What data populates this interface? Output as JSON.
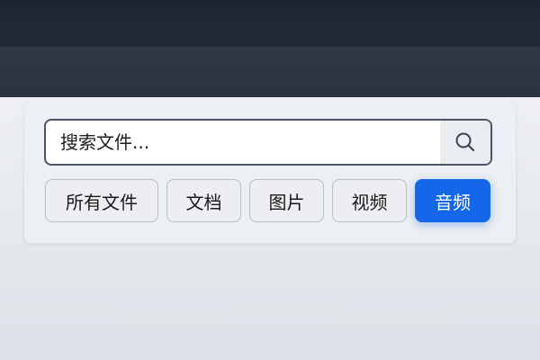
{
  "search": {
    "placeholder": "搜索文件..."
  },
  "filters": [
    {
      "label": "所有文件",
      "active": false
    },
    {
      "label": "文档",
      "active": false
    },
    {
      "label": "图片",
      "active": false
    },
    {
      "label": "视频",
      "active": false
    },
    {
      "label": "音频",
      "active": true
    }
  ],
  "colors": {
    "accent": "#1467e8",
    "header_dark": "#1d2533",
    "header": "#2f3644"
  },
  "icons": {
    "search_button": "search-icon"
  }
}
